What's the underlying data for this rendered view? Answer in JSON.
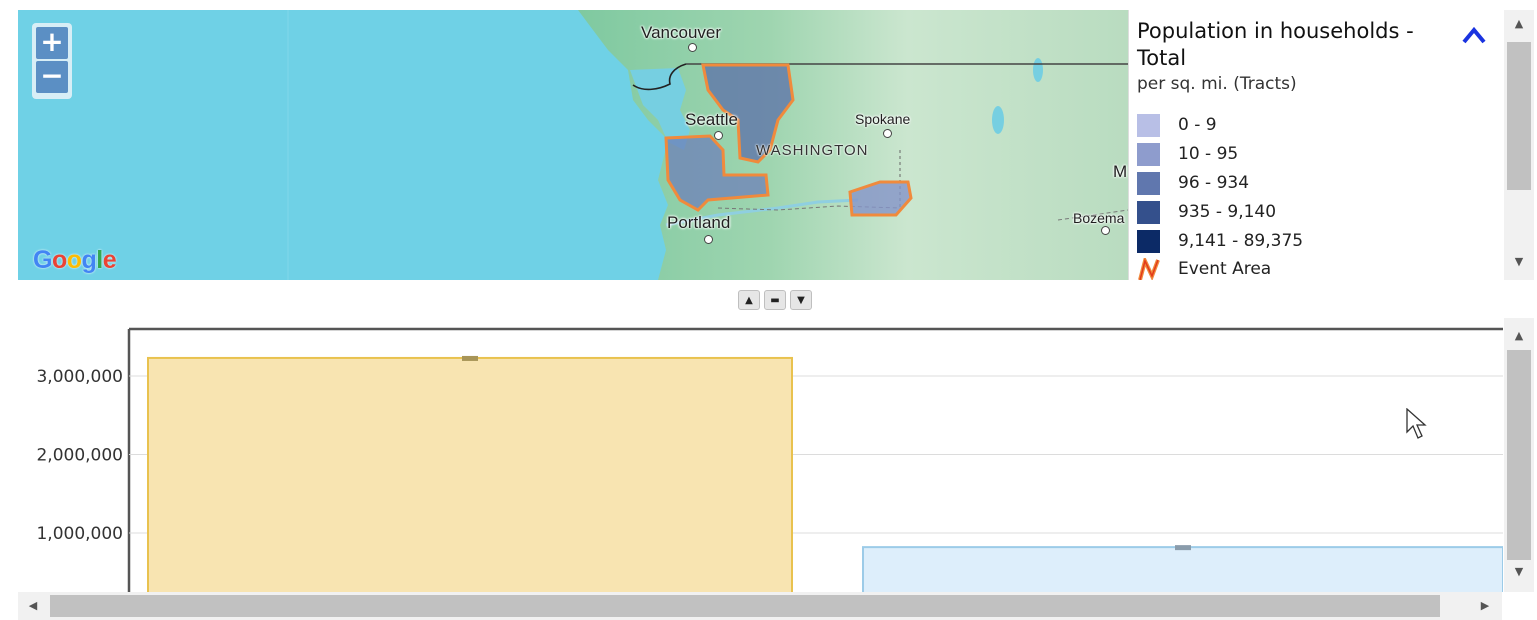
{
  "map": {
    "zoom_in": "+",
    "zoom_out": "−",
    "cities": [
      {
        "name": "Vancouver"
      },
      {
        "name": "Seattle"
      },
      {
        "name": "Spokane"
      },
      {
        "name": "Portland"
      },
      {
        "name": "Bozema"
      },
      {
        "name": "M"
      }
    ],
    "state": "WASHINGTON",
    "logo": [
      "G",
      "o",
      "o",
      "g",
      "l",
      "e"
    ],
    "logo_colors": [
      "#4285F4",
      "#EA4335",
      "#FBBC05",
      "#4285F4",
      "#34A853",
      "#EA4335"
    ]
  },
  "legend": {
    "title": "Population in households - Total",
    "subtitle": "per sq. mi. (Tracts)",
    "collapse_icon": "chevron-up-icon",
    "items": [
      {
        "label": "0 - 9",
        "color": "#b8bfe6"
      },
      {
        "label": "10 - 95",
        "color": "#8e9ccd"
      },
      {
        "label": "96 - 934",
        "color": "#6077ae"
      },
      {
        "label": "935 - 9,140",
        "color": "#34508c"
      },
      {
        "label": "9,141 - 89,375",
        "color": "#0c2a66"
      },
      {
        "label": "Event Area",
        "color": "#f08a3c"
      }
    ]
  },
  "splitter": {
    "up": "▲",
    "mid": "▬",
    "down": "▼"
  },
  "scrollbars": {
    "up": "▲",
    "down": "▼",
    "left": "◀",
    "right": "▶"
  },
  "chart_data": {
    "type": "bar",
    "y_ticks": [
      "3,000,000",
      "2,000,000",
      "1,000,000"
    ],
    "y_tick_values": [
      3000000,
      2000000,
      1000000
    ],
    "ylim": [
      0,
      3600000
    ],
    "series": [
      {
        "values": [
          3230000
        ],
        "color": "#f8e4b1",
        "stroke": "#e9c24e"
      },
      {
        "values": [
          820000
        ],
        "color": "#ddeefb",
        "stroke": "#9ccbe8"
      }
    ],
    "grid": true
  }
}
